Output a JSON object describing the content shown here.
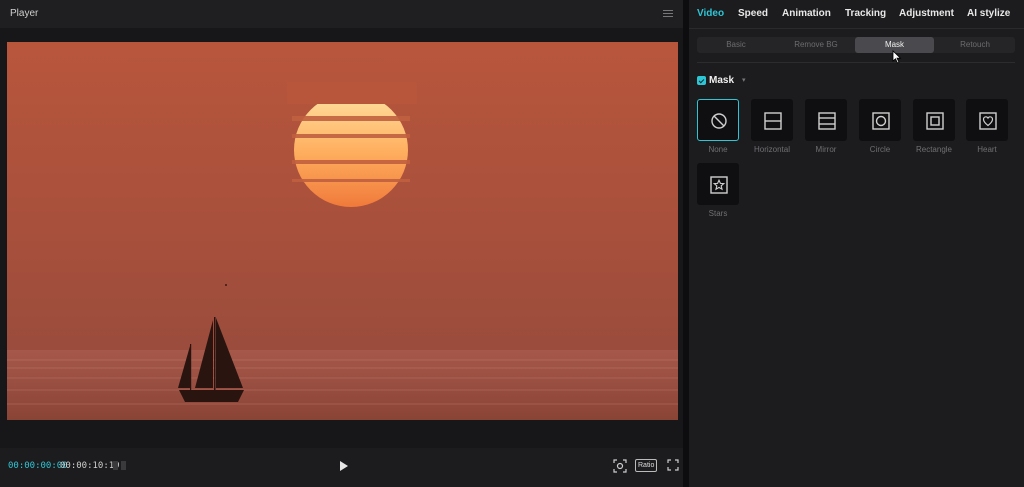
{
  "player": {
    "title": "Player",
    "current_time": "00:00:00:00",
    "total_time": "00:00:10:19",
    "ratio_label": "Ratio",
    "icons": [
      "menu-icon",
      "play-icon",
      "fit-view-icon",
      "fullscreen-icon"
    ]
  },
  "properties": {
    "tabs": [
      {
        "label": "Video",
        "active": true
      },
      {
        "label": "Speed"
      },
      {
        "label": "Animation"
      },
      {
        "label": "Tracking"
      },
      {
        "label": "Adjustment"
      },
      {
        "label": "AI stylize"
      }
    ],
    "subtabs": [
      {
        "label": "Basic"
      },
      {
        "label": "Remove BG"
      },
      {
        "label": "Mask",
        "active": true
      },
      {
        "label": "Retouch"
      }
    ],
    "mask": {
      "label": "Mask",
      "checked": true,
      "items": [
        {
          "label": "None",
          "icon": "none-icon",
          "selected": true
        },
        {
          "label": "Horizontal",
          "icon": "horizontal-icon"
        },
        {
          "label": "Mirror",
          "icon": "mirror-icon"
        },
        {
          "label": "Circle",
          "icon": "circle-icon"
        },
        {
          "label": "Rectangle",
          "icon": "rectangle-icon"
        },
        {
          "label": "Heart",
          "icon": "heart-icon"
        },
        {
          "label": "Stars",
          "icon": "star-icon"
        }
      ]
    }
  },
  "colors": {
    "accent": "#2ec6d6",
    "panel": "#1c1c1e",
    "sky": "#b5553c"
  }
}
